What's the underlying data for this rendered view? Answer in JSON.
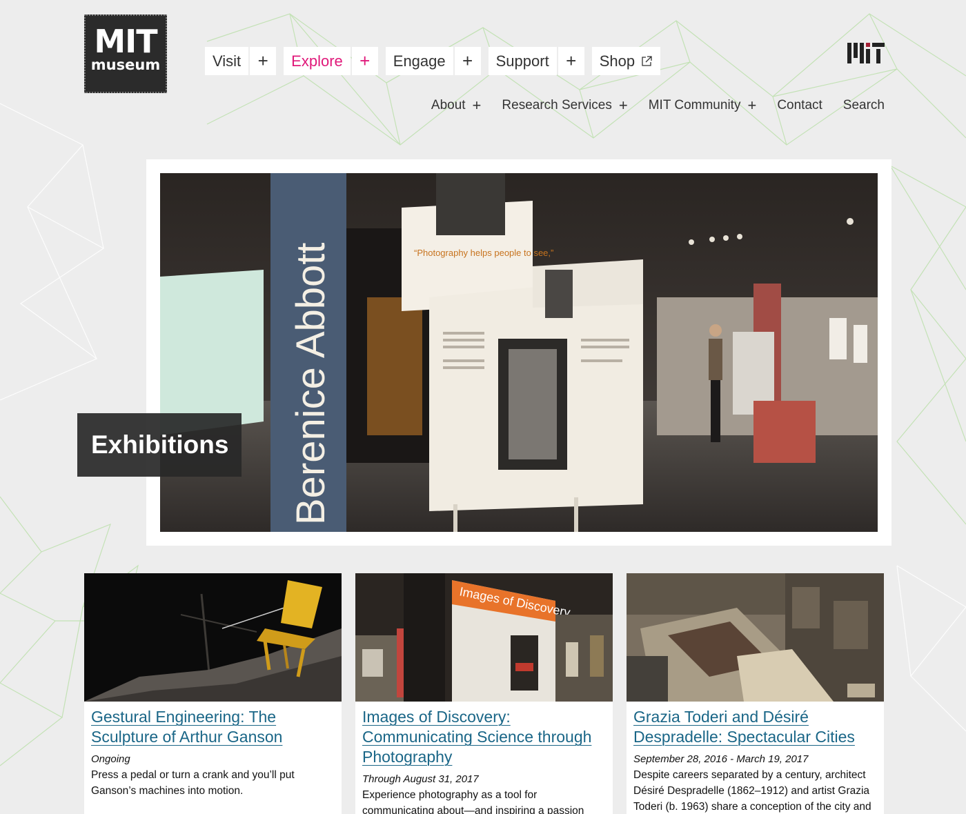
{
  "logo": {
    "line1": "MIT",
    "line2": "museum"
  },
  "main_nav": [
    {
      "label": "Visit",
      "has_plus": true,
      "active": false
    },
    {
      "label": "Explore",
      "has_plus": true,
      "active": true
    },
    {
      "label": "Engage",
      "has_plus": true,
      "active": false
    },
    {
      "label": "Support",
      "has_plus": true,
      "active": false
    },
    {
      "label": "Shop",
      "has_plus": false,
      "external": true
    }
  ],
  "plus_symbol": "+",
  "util_nav": [
    {
      "label": "About",
      "has_plus": true
    },
    {
      "label": "Research Services",
      "has_plus": true
    },
    {
      "label": "MIT Community",
      "has_plus": true
    },
    {
      "label": "Contact",
      "has_plus": false
    },
    {
      "label": "Search",
      "has_plus": false
    }
  ],
  "hero": {
    "label": "Exhibitions",
    "wall_text": "Berenice Abbott",
    "quote": "“Photography helps people to see,”"
  },
  "cards": [
    {
      "title": "Gestural Engineering: The Sculpture of Arthur Ganson",
      "date": "Ongoing",
      "desc": "Press a pedal or turn a crank and you’ll put Ganson’s machines into motion."
    },
    {
      "title": "Images of Discovery: Communicating Science through Photography",
      "date": "Through August 31, 2017",
      "desc": "Experience photography as a tool for communicating about—and inspiring a passion",
      "sign": "Images of Discovery"
    },
    {
      "title": "Grazia Toderi and Désiré Despradelle: Spectacular Cities",
      "date": "September 28, 2016 - March 19, 2017",
      "desc": "Despite careers separated by a century, architect Désiré Despradelle (1862–1912) and artist Grazia Toderi (b. 1963) share a conception of the city and"
    }
  ],
  "colors": {
    "accent_active": "#e0197a",
    "link": "#1a6687",
    "pattern_green": "#9fd48a",
    "pattern_white": "#ffffff"
  }
}
